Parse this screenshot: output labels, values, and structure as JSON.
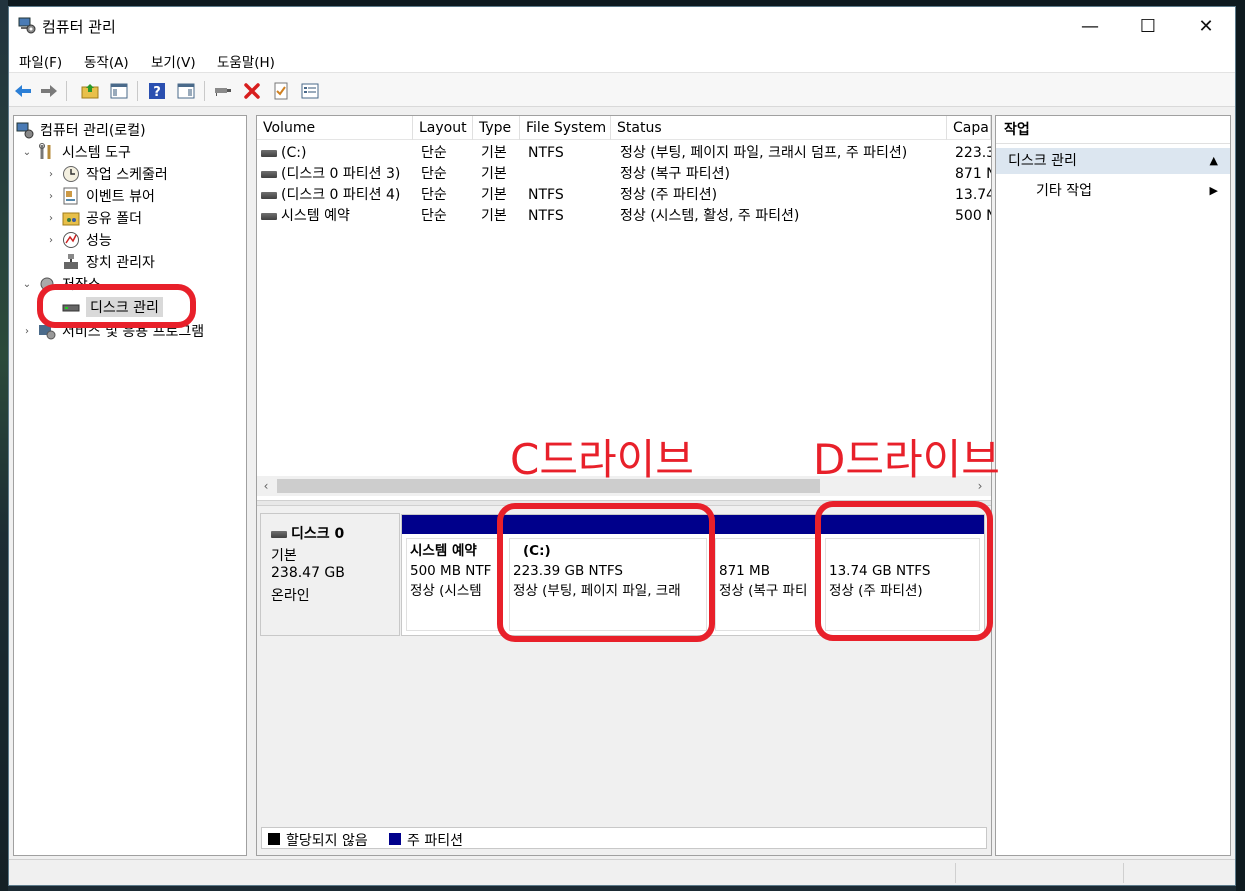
{
  "window": {
    "title": "컴퓨터 관리",
    "controls": {
      "minimize": "—",
      "maximize": "☐",
      "close": "✕"
    }
  },
  "menu": [
    "파일(F)",
    "동작(A)",
    "보기(V)",
    "도움말(H)"
  ],
  "toolbar_icons": [
    "back-icon",
    "forward-icon",
    "up-folder-icon",
    "show-hide-tree-icon",
    "help-icon",
    "show-hide-action-icon",
    "connect-icon",
    "delete-icon",
    "properties-icon",
    "list-icon"
  ],
  "tree": {
    "root": "컴퓨터 관리(로컬)",
    "system_tools": "시스템 도구",
    "task_scheduler": "작업 스케줄러",
    "event_viewer": "이벤트 뷰어",
    "shared_folders": "공유 폴더",
    "performance": "성능",
    "device_manager": "장치 관리자",
    "storage": "저장소",
    "disk_management": "디스크 관리",
    "services": "서비스 및 응용 프로그램"
  },
  "volume_table": {
    "columns": [
      "Volume",
      "Layout",
      "Type",
      "File System",
      "Status",
      "Capa"
    ],
    "rows": [
      {
        "volume": "(C:)",
        "layout": "단순",
        "type": "기본",
        "fs": "NTFS",
        "status": "정상 (부팅, 페이지 파일, 크래시 덤프, 주 파티션)",
        "capacity": "223.3"
      },
      {
        "volume": "(디스크 0 파티션 3)",
        "layout": "단순",
        "type": "기본",
        "fs": "",
        "status": "정상 (복구 파티션)",
        "capacity": "871 N"
      },
      {
        "volume": "(디스크 0 파티션 4)",
        "layout": "단순",
        "type": "기본",
        "fs": "NTFS",
        "status": "정상 (주 파티션)",
        "capacity": "13.74"
      },
      {
        "volume": "시스템 예약",
        "layout": "단순",
        "type": "기본",
        "fs": "NTFS",
        "status": "정상 (시스템, 활성, 주 파티션)",
        "capacity": "500 N"
      }
    ]
  },
  "disk": {
    "name": "디스크 0",
    "type": "기본",
    "size": "238.47 GB",
    "state": "온라인",
    "partitions": [
      {
        "title": "시스템 예약",
        "size": "500 MB NTF",
        "status": "정상 (시스템"
      },
      {
        "title": "(C:)",
        "size": "223.39 GB NTFS",
        "status": "정상 (부팅, 페이지 파일, 크래"
      },
      {
        "title": "",
        "size": "871 MB",
        "status": "정상 (복구 파티"
      },
      {
        "title": "",
        "size": "13.74 GB NTFS",
        "status": "정상 (주 파티션)"
      }
    ]
  },
  "legend": {
    "unallocated": "할당되지 않음",
    "primary": "주 파티션",
    "unallocated_color": "#000000",
    "primary_color": "#00008b"
  },
  "actions": {
    "header": "작업",
    "section": "디스크 관리",
    "more": "기타 작업"
  },
  "annotations": {
    "c_drive": "C드라이브",
    "d_drive": "D드라이브",
    "color": "#e8202a"
  }
}
